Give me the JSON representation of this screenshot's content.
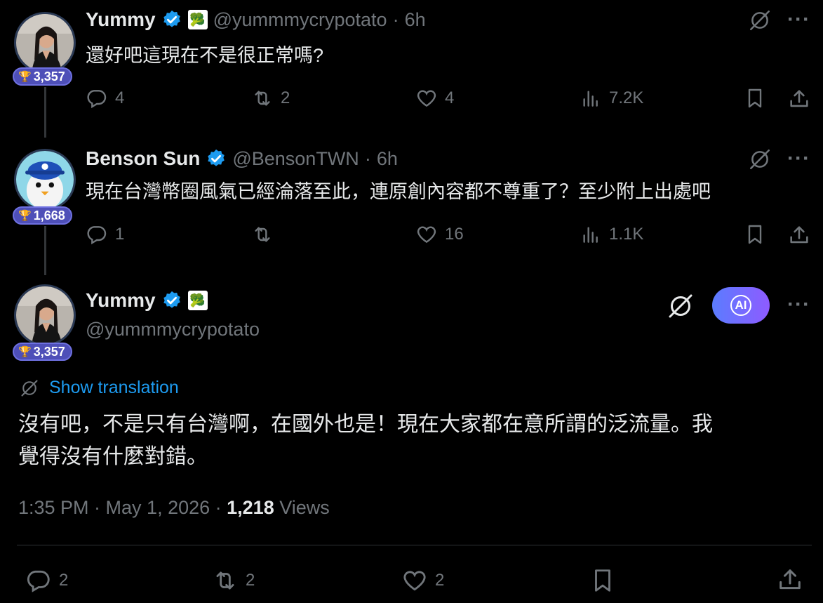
{
  "tweets": [
    {
      "name": "Yummy",
      "handle": "@yummmycrypotato",
      "time": "6h",
      "score": "3,357",
      "text": "還好吧這現在不是很正常嗎?",
      "replies": "4",
      "retweets": "2",
      "likes": "4",
      "views": "7.2K"
    },
    {
      "name": "Benson Sun",
      "handle": "@BensonTWN",
      "time": "6h",
      "score": "1,668",
      "text": "現在台灣幣圈風氣已經淪落至此，連原創內容都不尊重了？至少附上出處吧",
      "replies": "1",
      "retweets": "",
      "likes": "16",
      "views": "1.1K"
    }
  ],
  "main": {
    "name": "Yummy",
    "handle": "@yummmycrypotato",
    "score": "3,357",
    "ai_label": "AI",
    "show_translation": "Show translation",
    "text_line1": "沒有吧，不是只有台灣啊，在國外也是！現在大家都在意所謂的泛流量。我",
    "text_line2": "覺得沒有什麼對錯。",
    "timestamp": "1:35 PM · May 1, 2026 · ",
    "views_count": "1,218",
    "views_label": " Views",
    "replies": "2",
    "retweets": "2",
    "likes": "2"
  },
  "icons": {
    "reply": "reply-icon",
    "retweet": "retweet-icon",
    "like": "heart-icon",
    "views": "views-icon",
    "bookmark": "bookmark-icon",
    "share": "share-icon",
    "verified": "verified-badge-icon",
    "no-entry": "slash-circle-icon",
    "more": "more-icon"
  },
  "colors": {
    "verified": "#1d9bf0",
    "link": "#1d9bf0",
    "badge": "#4e4fb8",
    "ai_gradient_start": "#5b7cff",
    "ai_gradient_end": "#8e5bff"
  }
}
